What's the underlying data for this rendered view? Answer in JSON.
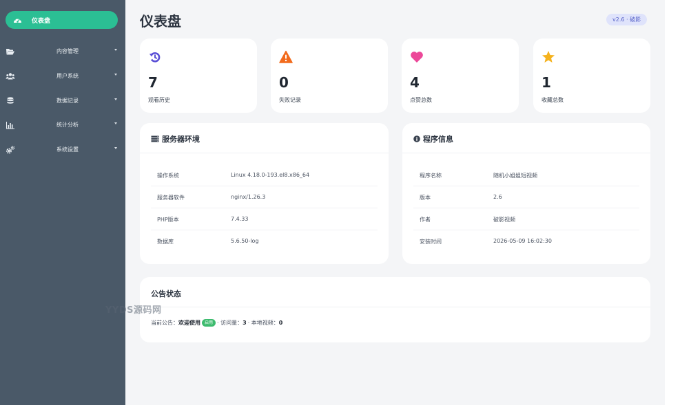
{
  "sidebar": {
    "active": {
      "label": "仪表盘",
      "icon": "dashboard-gauge-icon"
    },
    "items": [
      {
        "label": "内容管理",
        "icon": "folder-open-icon"
      },
      {
        "label": "用户系统",
        "icon": "users-icon"
      },
      {
        "label": "数据记录",
        "icon": "database-icon"
      },
      {
        "label": "统计分析",
        "icon": "bar-chart-icon"
      },
      {
        "label": "系统设置",
        "icon": "cogs-icon"
      }
    ]
  },
  "header": {
    "title": "仪表盘",
    "version_badge": "v2.6 · 破影"
  },
  "stats": [
    {
      "value": "7",
      "label": "观看历史",
      "icon": "history-icon",
      "color": "#5a4fd6"
    },
    {
      "value": "0",
      "label": "失败记录",
      "icon": "warning-triangle-icon",
      "color": "#f26b1d"
    },
    {
      "value": "4",
      "label": "点赞总数",
      "icon": "heart-icon",
      "color": "#ec4899"
    },
    {
      "value": "1",
      "label": "收藏总数",
      "icon": "star-icon",
      "color": "#f5b21d"
    }
  ],
  "server_panel": {
    "title": "服务器环境",
    "rows": [
      {
        "key": "操作系统",
        "value": "Linux 4.18.0-193.el8.x86_64"
      },
      {
        "key": "服务器软件",
        "value": "nginx/1.26.3"
      },
      {
        "key": "PHP版本",
        "value": "7.4.33"
      },
      {
        "key": "数据库",
        "value": "5.6.50-log"
      }
    ]
  },
  "program_panel": {
    "title": "程序信息",
    "rows": [
      {
        "key": "程序名称",
        "value": "随机小姐姐短视频"
      },
      {
        "key": "版本",
        "value": "2.6"
      },
      {
        "key": "作者",
        "value": "破影视频"
      },
      {
        "key": "安装时间",
        "value": "2026-05-09 16:02:30"
      }
    ]
  },
  "announcement": {
    "title": "公告状态",
    "prefix": "当前公告：",
    "notice": "欢迎使用",
    "status": "启用",
    "visits_label": "· 访问量：",
    "visits": "3",
    "local_label": "· 本地视频：",
    "local": "0"
  },
  "watermark": "YYDS源码网",
  "colors": {
    "sidebar_bg": "#4a5968",
    "accent": "#2bbf94",
    "page_bg": "#f4f5f7"
  }
}
